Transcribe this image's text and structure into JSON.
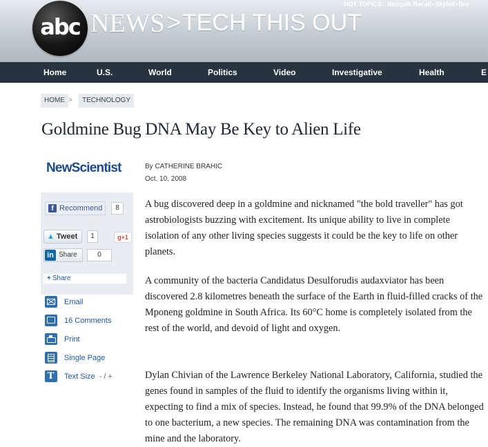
{
  "header": {
    "hot_topics_label": "HOT TOPICS:",
    "hot_topics": [
      "Nesquik Recall",
      "Skyfall",
      "Bro"
    ],
    "logo_text": "abc",
    "brand_word": "NEWS",
    "section_title": "TECH THIS OUT",
    "section_chevron": ">"
  },
  "nav": {
    "items": [
      "Home",
      "U.S.",
      "World",
      "Politics",
      "Video",
      "Investigative",
      "Health",
      "E"
    ]
  },
  "breadcrumb": {
    "items": [
      "HOME",
      "TECHNOLOGY"
    ],
    "separator": ">"
  },
  "article": {
    "title": "Goldmine Bug DNA May Be Key to Alien Life",
    "source_logo": "NewScientist",
    "byline": "By CATHERINE BRAHIC",
    "date": "Oct. 10, 2008",
    "paragraphs": [
      "A bug discovered deep in a goldmine and nicknamed \"the bold traveller\" has got astrobiologists buzzing with excitement. Its unique ability to live in complete isolation of any other living species suggests it could be the key to life on other planets.",
      "A community of the bacteria Candidatus Desulforudis audaxviator has been discovered 2.8 kilometres beneath the surface of the Earth in fluid-filled cracks of the Mponeng goldmine in South Africa. Its 60°C home is completely isolated from the rest of the world, and devoid of light and oxygen.",
      "Dylan Chivian of the Lawrence Berkeley National Laboratory, California, studied the genes found in samples of the fluid to identify the organisms living within it, expecting to find a mix of species. Instead, he found that 99.9% of the DNA belonged to one bacterium, a new species. The remaining DNA was contamination from the mine and the laboratory."
    ]
  },
  "share": {
    "facebook_label": "Recommend",
    "facebook_icon": "f",
    "facebook_count": "8",
    "twitter_label": "Tweet",
    "twitter_icon": "bird-icon",
    "twitter_count": "1",
    "gplus_label": "+1",
    "gplus_icon": "g",
    "linkedin_label": "Share",
    "linkedin_icon": "in",
    "linkedin_count": "0",
    "more_label": "Share",
    "more_plus": "+"
  },
  "tools": {
    "email": "Email",
    "comments": "16 Comments",
    "print": "Print",
    "single_page": "Single Page",
    "text_size": "Text Size",
    "text_size_controls": "- / +"
  },
  "colors": {
    "nav_bg": "#283340",
    "link_blue": "#1f58a0",
    "icon_blue": "#2d6fb1",
    "panel_bg": "#e9edf1"
  }
}
